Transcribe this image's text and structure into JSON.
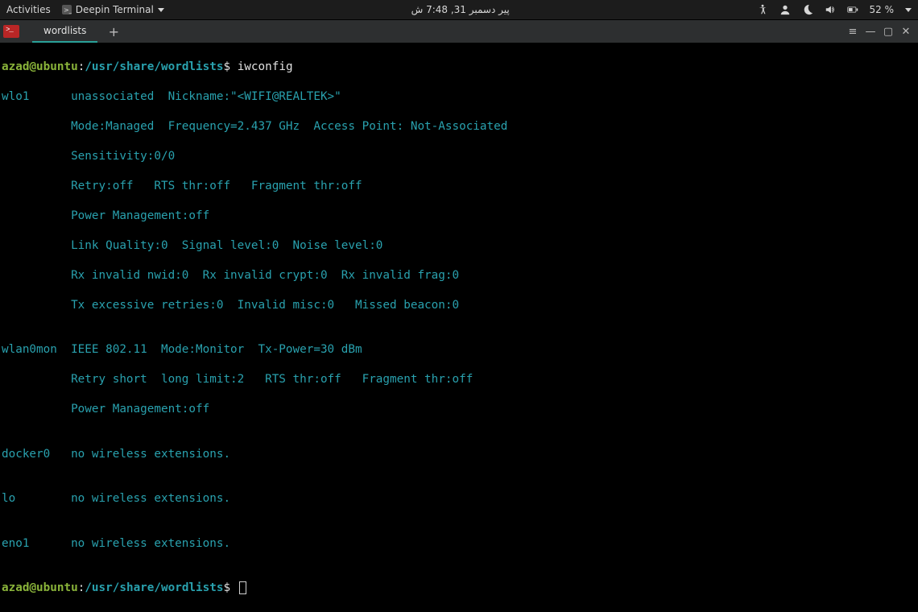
{
  "topbar": {
    "activities": "Activities",
    "app_name": "Deepin Terminal",
    "clock": "پیر دسمبر 31, 7:48 ش",
    "battery": "52 %"
  },
  "tabbar": {
    "tab_label": "wordlists",
    "plus": "+",
    "hamburger": "≡",
    "minimize": "—",
    "maximize": "▢",
    "close": "✕"
  },
  "prompt1": {
    "user": "azad",
    "at": "@",
    "host": "ubuntu",
    "colon": ":",
    "path": "/usr/share/wordlists",
    "dollar": "$ ",
    "command": "iwconfig"
  },
  "output": {
    "l1": "wlo1      unassociated  Nickname:\"<WIFI@REALTEK>\"",
    "l2": "          Mode:Managed  Frequency=2.437 GHz  Access Point: Not-Associated",
    "l3": "          Sensitivity:0/0",
    "l4": "          Retry:off   RTS thr:off   Fragment thr:off",
    "l5": "          Power Management:off",
    "l6": "          Link Quality:0  Signal level:0  Noise level:0",
    "l7": "          Rx invalid nwid:0  Rx invalid crypt:0  Rx invalid frag:0",
    "l8": "          Tx excessive retries:0  Invalid misc:0   Missed beacon:0",
    "l9": "",
    "l10": "wlan0mon  IEEE 802.11  Mode:Monitor  Tx-Power=30 dBm",
    "l11": "          Retry short  long limit:2   RTS thr:off   Fragment thr:off",
    "l12": "          Power Management:off",
    "l13": "",
    "l14": "docker0   no wireless extensions.",
    "l15": "",
    "l16": "lo        no wireless extensions.",
    "l17": "",
    "l18": "eno1      no wireless extensions.",
    "l19": ""
  },
  "prompt2": {
    "user": "azad",
    "at": "@",
    "host": "ubuntu",
    "colon": ":",
    "path": "/usr/share/wordlists",
    "dollar": "$ "
  }
}
